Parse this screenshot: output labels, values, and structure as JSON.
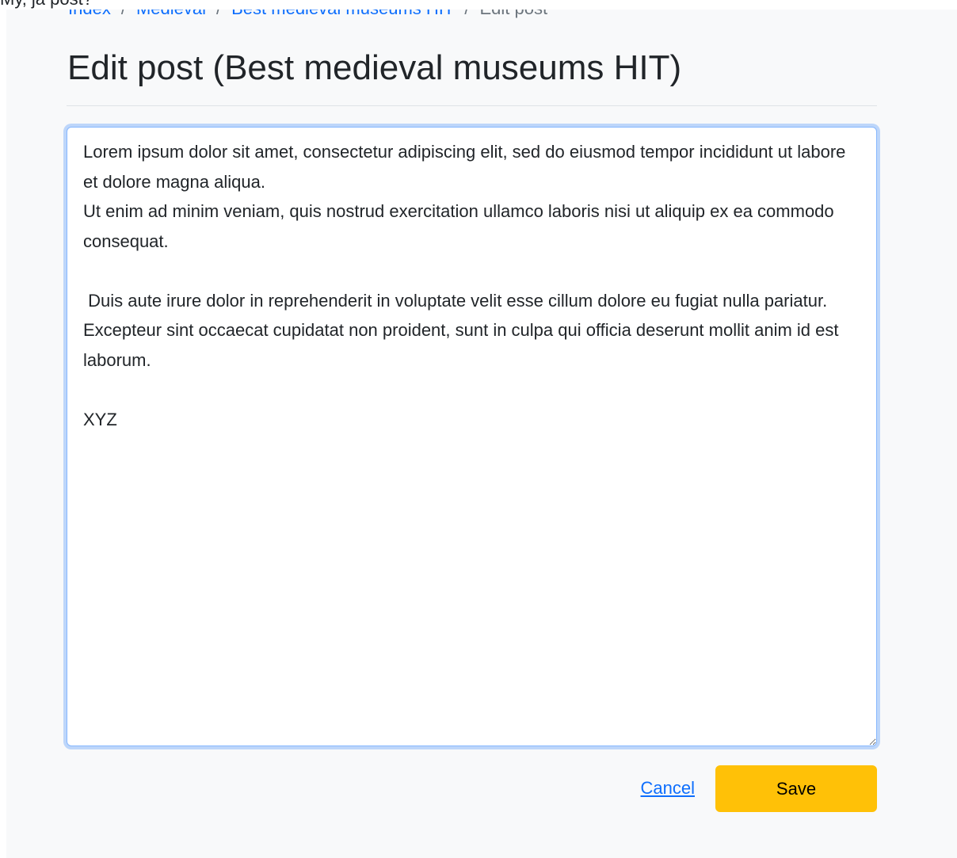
{
  "top_strip": {
    "label": "My, ja post?"
  },
  "breadcrumb": {
    "items": [
      "Index",
      "Medieval",
      "Best medieval museums HIT"
    ],
    "separator": "/",
    "current": "Edit post"
  },
  "page": {
    "title": "Edit post (Best medieval museums HIT)"
  },
  "editor": {
    "value": "Lorem ipsum dolor sit amet, consectetur adipiscing elit, sed do eiusmod tempor incididunt ut labore et dolore magna aliqua.\nUt enim ad minim veniam, quis nostrud exercitation ullamco laboris nisi ut aliquip ex ea commodo consequat.\n\n Duis aute irure dolor in reprehenderit in voluptate velit esse cillum dolore eu fugiat nulla pariatur.\nExcepteur sint occaecat cupidatat non proident, sunt in culpa qui officia deserunt mollit anim id est laborum.\n\nXYZ"
  },
  "actions": {
    "cancel_label": "Cancel",
    "save_label": "Save"
  },
  "colors": {
    "link": "#0d6efd",
    "save_button": "#ffc107",
    "focus_ring": "#86b7fe",
    "page_background": "#f8f9fa"
  }
}
